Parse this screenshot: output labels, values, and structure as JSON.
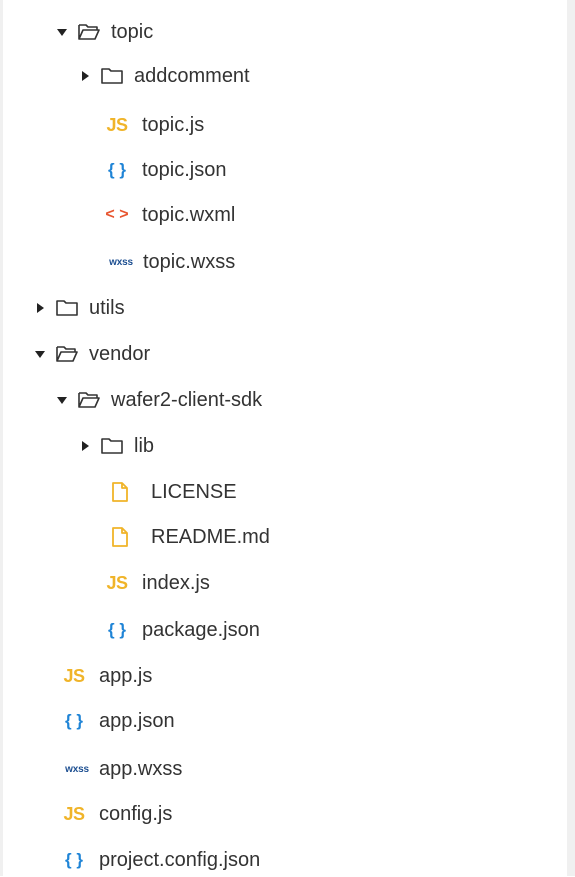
{
  "tree": {
    "topic": {
      "label": "topic",
      "state": "expanded",
      "icon": "folder-open-icon"
    },
    "addcomment": {
      "label": "addcomment",
      "state": "collapsed",
      "icon": "folder-icon"
    },
    "topic_js": {
      "label": "topic.js",
      "icon_text": "JS"
    },
    "topic_json": {
      "label": "topic.json",
      "icon_text": "{ }"
    },
    "topic_wxml": {
      "label": "topic.wxml",
      "icon_text": "< >"
    },
    "topic_wxss": {
      "label": "topic.wxss",
      "icon_text": "wxss"
    },
    "utils": {
      "label": "utils",
      "state": "collapsed",
      "icon": "folder-icon"
    },
    "vendor": {
      "label": "vendor",
      "state": "expanded",
      "icon": "folder-open-icon"
    },
    "wafer2": {
      "label": "wafer2-client-sdk",
      "state": "expanded",
      "icon": "folder-open-icon"
    },
    "lib": {
      "label": "lib",
      "state": "collapsed",
      "icon": "folder-icon"
    },
    "license": {
      "label": "LICENSE",
      "icon": "file-icon"
    },
    "readme": {
      "label": "README.md",
      "icon": "file-icon"
    },
    "index_js": {
      "label": "index.js",
      "icon_text": "JS"
    },
    "package_json": {
      "label": "package.json",
      "icon_text": "{ }"
    },
    "app_js": {
      "label": "app.js",
      "icon_text": "JS"
    },
    "app_json": {
      "label": "app.json",
      "icon_text": "{ }"
    },
    "app_wxss": {
      "label": "app.wxss",
      "icon_text": "wxss"
    },
    "config_js": {
      "label": "config.js",
      "icon_text": "JS"
    },
    "project_config_json": {
      "label": "project.config.json",
      "icon_text": "{ }"
    }
  },
  "colors": {
    "js": "#f0b429",
    "json": "#1f84d6",
    "wxml": "#e8542e",
    "wxss": "#1d4f91",
    "file": "#f0b429",
    "folder_stroke": "#333333",
    "text": "#333333"
  }
}
